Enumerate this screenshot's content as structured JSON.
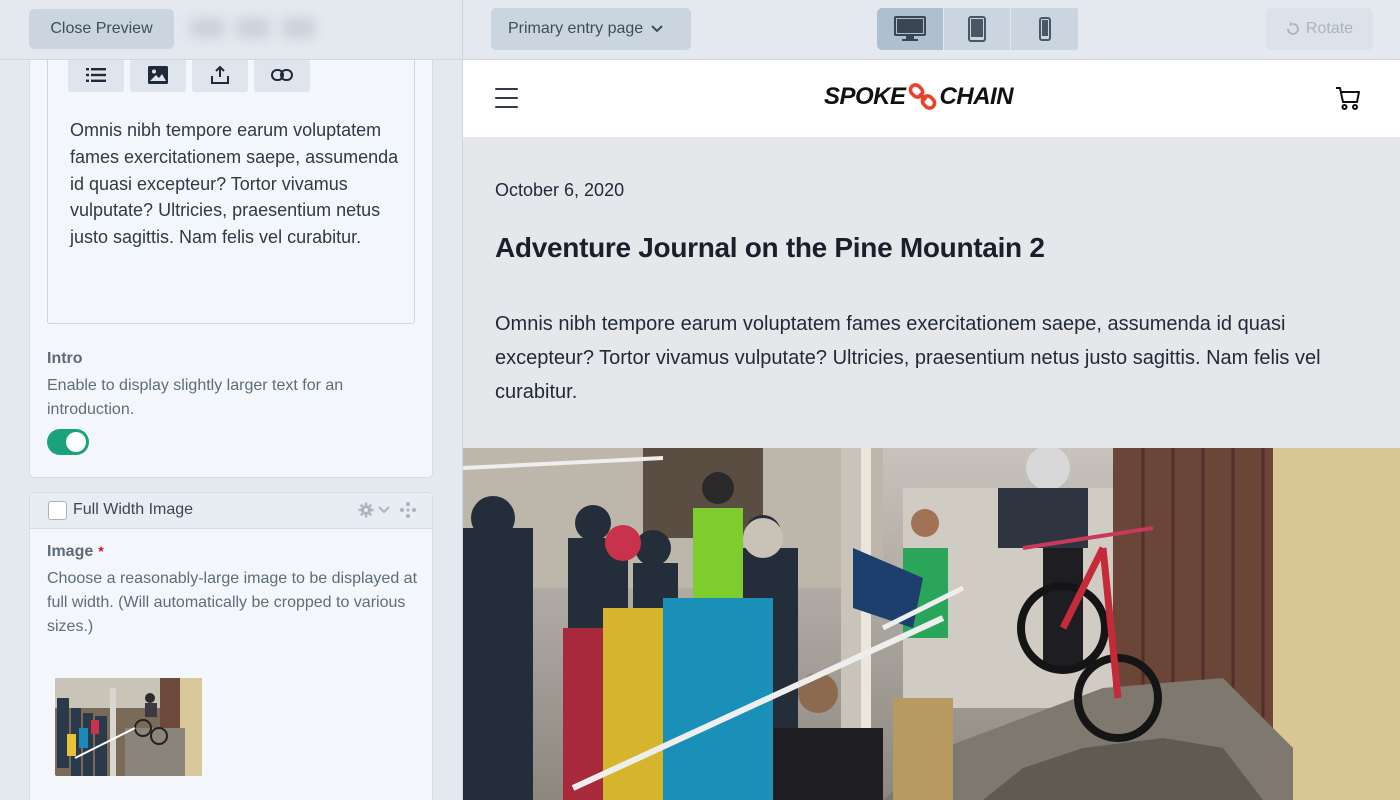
{
  "left": {
    "close_preview": "Close Preview",
    "rte_toolbar": [
      "list-icon",
      "image-icon",
      "upload-icon",
      "link-icon"
    ],
    "body_text": "Omnis nibh tempore earum voluptatem fames exercitationem saepe, assumenda id quasi excepteur? Tortor vivamus vulputate? Ultricies, praesentium netus justo sagittis. Nam felis vel curabitur.",
    "intro": {
      "label": "Intro",
      "help": "Enable to display slightly larger text for an introduction.",
      "enabled": true
    },
    "block": {
      "title": "Full Width Image",
      "field_label": "Image",
      "required_mark": "*",
      "help": "Choose a reasonably-large image to be displayed at full width. (Will automatically be cropped to various sizes.)"
    }
  },
  "preview": {
    "entry_select": "Primary entry page",
    "devices": [
      "desktop-icon",
      "tablet-icon",
      "phone-icon"
    ],
    "active_device": "desktop",
    "rotate_label": "Rotate",
    "logo_left": "SPOKE",
    "logo_right": "CHAIN",
    "article": {
      "date": "October 6, 2020",
      "title": "Adventure Journal on the Pine Mountain 2",
      "body": "Omnis nibh tempore earum voluptatem fames exercitationem saepe, assumenda id quasi excepteur? Tortor vivamus vulputate? Ultricies, praesentium netus justo sagittis. Nam felis vel curabitur."
    }
  },
  "colors": {
    "toggle_on": "#1aa37a",
    "logo_accent": "#e8432a",
    "required": "#cf1124"
  }
}
